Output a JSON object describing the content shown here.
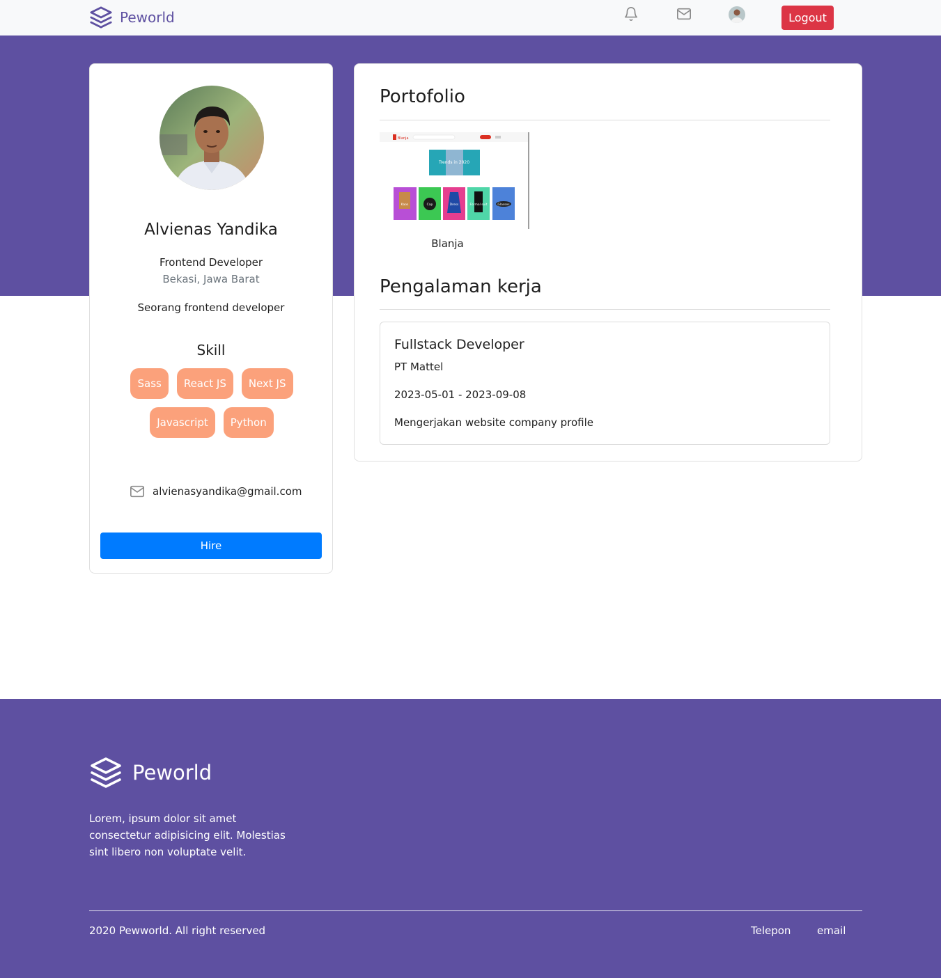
{
  "colors": {
    "brand": "#5e50a1",
    "logout": "#dc3545",
    "hire": "#007bff",
    "skill_badge": "#fba17b"
  },
  "navbar": {
    "brand": "Peworld",
    "icons": [
      "bell-icon",
      "mail-icon"
    ],
    "logout_label": "Logout"
  },
  "profile": {
    "name": "Alvienas Yandika",
    "job": "Frontend Developer",
    "location": "Bekasi, Jawa Barat",
    "description": "Seorang frontend developer",
    "skill_title": "Skill",
    "skills": [
      "Sass",
      "React JS",
      "Next JS",
      "Javascript",
      "Python"
    ],
    "email": "alvienasyandika@gmail.com",
    "hire_label": "Hire"
  },
  "portfolio": {
    "title": "Portofolio",
    "items": [
      {
        "label": "Blanja",
        "preview": {
          "brand": "Blanja",
          "banner": "Trends in 2020",
          "categories": [
            "Kaos",
            "Cap",
            "Dress",
            "Formal suit",
            "Glasses"
          ]
        }
      }
    ]
  },
  "experience": {
    "title": "Pengalaman kerja",
    "items": [
      {
        "position": "Fullstack Developer",
        "company": "PT Mattel",
        "date": "2023-05-01 - 2023-09-08",
        "description": "Mengerjakan website company profile"
      }
    ]
  },
  "footer": {
    "brand": "Peworld",
    "description": "Lorem, ipsum dolor sit amet consectetur adipisicing elit. Molestias sint libero non voluptate velit.",
    "copyright": "2020 Pewworld. All right reserved",
    "links": [
      "Telepon",
      "email"
    ]
  }
}
